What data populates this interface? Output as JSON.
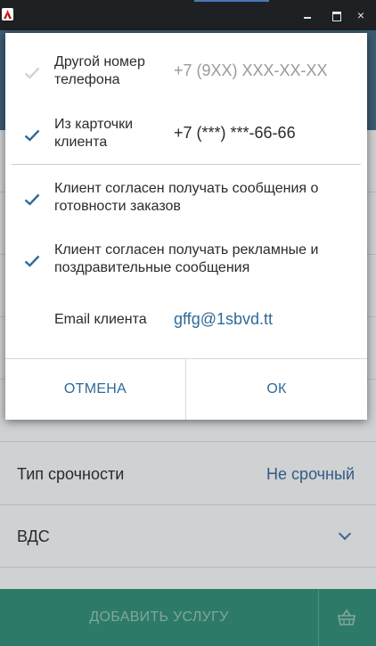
{
  "window": {
    "icon": "app-logo-icon",
    "controls": {
      "minimize": "minimize-icon",
      "maximize": "maximize-icon",
      "close": "×"
    }
  },
  "background": {
    "rows": [
      {
        "label": "",
        "value": ""
      },
      {
        "label": "",
        "value": ""
      },
      {
        "label": "",
        "value": ""
      },
      {
        "label": "",
        "value": ""
      },
      {
        "label": "",
        "value": ""
      },
      {
        "label": "Тип срочности",
        "value": "Не срочный"
      },
      {
        "label": "ВДС",
        "value": ""
      }
    ],
    "add_service_label": "ДОБАВИТЬ УСЛУГУ",
    "basket_icon": "basket-icon",
    "colors": {
      "header": "#3c5c74",
      "footer": "#2e7a68",
      "link": "#315b86"
    }
  },
  "dialog": {
    "options": [
      {
        "name": "Другой номер телефона",
        "value": "+7 (9XX) XXX-XX-XX",
        "checked": false
      },
      {
        "name": "Из карточки клиента",
        "value": "+7 (***) ***-66-66",
        "checked": true
      },
      {
        "name": "Клиент согласен получать сообщения о готовности заказов",
        "value": "",
        "checked": true
      },
      {
        "name": "Клиент согласен получать рекламные и поздравительные сообщения",
        "value": "",
        "checked": true
      }
    ],
    "email": {
      "label": "Email клиента",
      "value": "gffg@1sbvd.tt"
    },
    "buttons": {
      "cancel": "ОТМЕНА",
      "ok": "ОК"
    },
    "colors": {
      "check_on": "#2f6a99",
      "check_off": "#c9d6e0",
      "link": "#2f6a99",
      "placeholder": "#9a9a9a"
    }
  }
}
